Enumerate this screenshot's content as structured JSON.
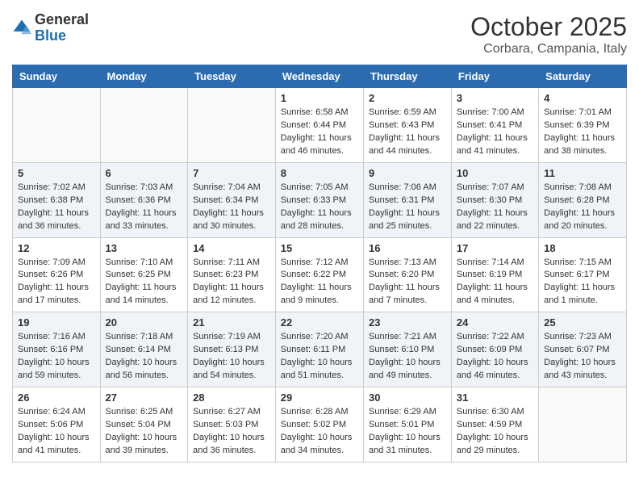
{
  "header": {
    "logo_general": "General",
    "logo_blue": "Blue",
    "month": "October 2025",
    "location": "Corbara, Campania, Italy"
  },
  "days_of_week": [
    "Sunday",
    "Monday",
    "Tuesday",
    "Wednesday",
    "Thursday",
    "Friday",
    "Saturday"
  ],
  "weeks": [
    [
      {
        "day": "",
        "info": ""
      },
      {
        "day": "",
        "info": ""
      },
      {
        "day": "",
        "info": ""
      },
      {
        "day": "1",
        "info": "Sunrise: 6:58 AM\nSunset: 6:44 PM\nDaylight: 11 hours\nand 46 minutes."
      },
      {
        "day": "2",
        "info": "Sunrise: 6:59 AM\nSunset: 6:43 PM\nDaylight: 11 hours\nand 44 minutes."
      },
      {
        "day": "3",
        "info": "Sunrise: 7:00 AM\nSunset: 6:41 PM\nDaylight: 11 hours\nand 41 minutes."
      },
      {
        "day": "4",
        "info": "Sunrise: 7:01 AM\nSunset: 6:39 PM\nDaylight: 11 hours\nand 38 minutes."
      }
    ],
    [
      {
        "day": "5",
        "info": "Sunrise: 7:02 AM\nSunset: 6:38 PM\nDaylight: 11 hours\nand 36 minutes."
      },
      {
        "day": "6",
        "info": "Sunrise: 7:03 AM\nSunset: 6:36 PM\nDaylight: 11 hours\nand 33 minutes."
      },
      {
        "day": "7",
        "info": "Sunrise: 7:04 AM\nSunset: 6:34 PM\nDaylight: 11 hours\nand 30 minutes."
      },
      {
        "day": "8",
        "info": "Sunrise: 7:05 AM\nSunset: 6:33 PM\nDaylight: 11 hours\nand 28 minutes."
      },
      {
        "day": "9",
        "info": "Sunrise: 7:06 AM\nSunset: 6:31 PM\nDaylight: 11 hours\nand 25 minutes."
      },
      {
        "day": "10",
        "info": "Sunrise: 7:07 AM\nSunset: 6:30 PM\nDaylight: 11 hours\nand 22 minutes."
      },
      {
        "day": "11",
        "info": "Sunrise: 7:08 AM\nSunset: 6:28 PM\nDaylight: 11 hours\nand 20 minutes."
      }
    ],
    [
      {
        "day": "12",
        "info": "Sunrise: 7:09 AM\nSunset: 6:26 PM\nDaylight: 11 hours\nand 17 minutes."
      },
      {
        "day": "13",
        "info": "Sunrise: 7:10 AM\nSunset: 6:25 PM\nDaylight: 11 hours\nand 14 minutes."
      },
      {
        "day": "14",
        "info": "Sunrise: 7:11 AM\nSunset: 6:23 PM\nDaylight: 11 hours\nand 12 minutes."
      },
      {
        "day": "15",
        "info": "Sunrise: 7:12 AM\nSunset: 6:22 PM\nDaylight: 11 hours\nand 9 minutes."
      },
      {
        "day": "16",
        "info": "Sunrise: 7:13 AM\nSunset: 6:20 PM\nDaylight: 11 hours\nand 7 minutes."
      },
      {
        "day": "17",
        "info": "Sunrise: 7:14 AM\nSunset: 6:19 PM\nDaylight: 11 hours\nand 4 minutes."
      },
      {
        "day": "18",
        "info": "Sunrise: 7:15 AM\nSunset: 6:17 PM\nDaylight: 11 hours\nand 1 minute."
      }
    ],
    [
      {
        "day": "19",
        "info": "Sunrise: 7:16 AM\nSunset: 6:16 PM\nDaylight: 10 hours\nand 59 minutes."
      },
      {
        "day": "20",
        "info": "Sunrise: 7:18 AM\nSunset: 6:14 PM\nDaylight: 10 hours\nand 56 minutes."
      },
      {
        "day": "21",
        "info": "Sunrise: 7:19 AM\nSunset: 6:13 PM\nDaylight: 10 hours\nand 54 minutes."
      },
      {
        "day": "22",
        "info": "Sunrise: 7:20 AM\nSunset: 6:11 PM\nDaylight: 10 hours\nand 51 minutes."
      },
      {
        "day": "23",
        "info": "Sunrise: 7:21 AM\nSunset: 6:10 PM\nDaylight: 10 hours\nand 49 minutes."
      },
      {
        "day": "24",
        "info": "Sunrise: 7:22 AM\nSunset: 6:09 PM\nDaylight: 10 hours\nand 46 minutes."
      },
      {
        "day": "25",
        "info": "Sunrise: 7:23 AM\nSunset: 6:07 PM\nDaylight: 10 hours\nand 43 minutes."
      }
    ],
    [
      {
        "day": "26",
        "info": "Sunrise: 6:24 AM\nSunset: 5:06 PM\nDaylight: 10 hours\nand 41 minutes."
      },
      {
        "day": "27",
        "info": "Sunrise: 6:25 AM\nSunset: 5:04 PM\nDaylight: 10 hours\nand 39 minutes."
      },
      {
        "day": "28",
        "info": "Sunrise: 6:27 AM\nSunset: 5:03 PM\nDaylight: 10 hours\nand 36 minutes."
      },
      {
        "day": "29",
        "info": "Sunrise: 6:28 AM\nSunset: 5:02 PM\nDaylight: 10 hours\nand 34 minutes."
      },
      {
        "day": "30",
        "info": "Sunrise: 6:29 AM\nSunset: 5:01 PM\nDaylight: 10 hours\nand 31 minutes."
      },
      {
        "day": "31",
        "info": "Sunrise: 6:30 AM\nSunset: 4:59 PM\nDaylight: 10 hours\nand 29 minutes."
      },
      {
        "day": "",
        "info": ""
      }
    ]
  ]
}
